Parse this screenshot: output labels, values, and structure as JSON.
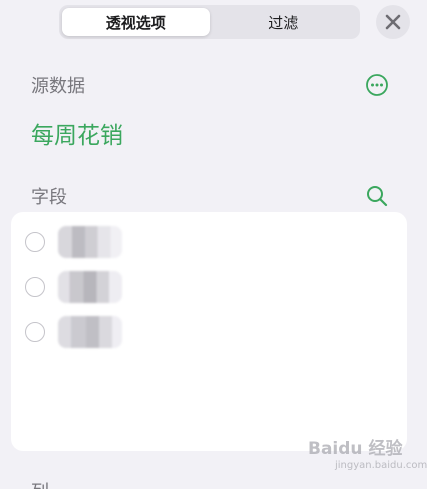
{
  "tabs": [
    {
      "label": "透视选项",
      "active": true
    },
    {
      "label": "过滤",
      "active": false
    }
  ],
  "source_section": {
    "label": "源数据",
    "value": "每周花销"
  },
  "fields_section": {
    "label": "字段",
    "items": [
      {
        "name": "",
        "selected": false
      },
      {
        "name": "",
        "selected": false
      },
      {
        "name": "",
        "selected": false
      }
    ]
  },
  "columns_section": {
    "label": "列"
  },
  "watermark": {
    "text": "Baidu 经验",
    "sub": "jingyan.baidu.com"
  },
  "colors": {
    "accent": "#3ba75e",
    "background": "#f2f1f6",
    "card": "#ffffff",
    "muted_text": "#78777d"
  },
  "icons": {
    "close": "close-icon",
    "more": "more-icon",
    "search": "search-icon"
  }
}
